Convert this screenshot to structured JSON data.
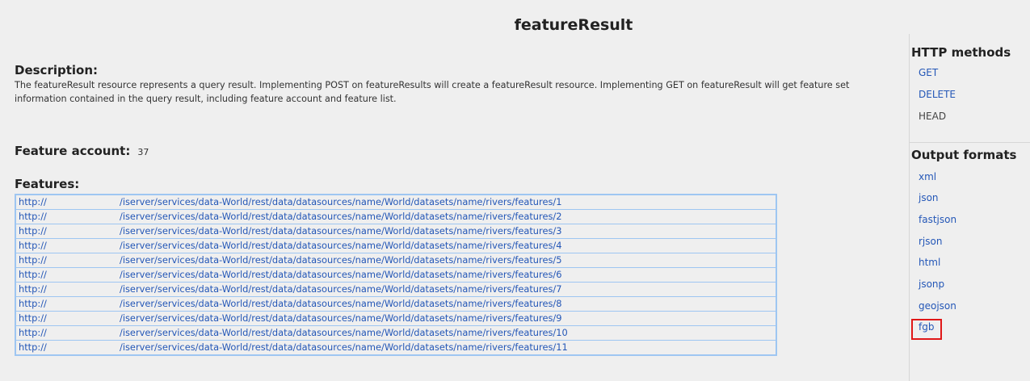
{
  "title": "featureResult",
  "description": {
    "heading": "Description:",
    "text": "The featureResult resource represents a query result. Implementing POST on featureResults will create a featureResult resource. Implementing GET on featureResult will get feature set information contained in the query result, including feature account and feature list."
  },
  "feature_account": {
    "label": "Feature account:",
    "value": "37"
  },
  "features": {
    "heading": "Features:",
    "rows": [
      {
        "scheme": "http://",
        "path": "/iserver/services/data-World/rest/data/datasources/name/World/datasets/name/rivers/features/1"
      },
      {
        "scheme": "http://",
        "path": "/iserver/services/data-World/rest/data/datasources/name/World/datasets/name/rivers/features/2"
      },
      {
        "scheme": "http://",
        "path": "/iserver/services/data-World/rest/data/datasources/name/World/datasets/name/rivers/features/3"
      },
      {
        "scheme": "http://",
        "path": "/iserver/services/data-World/rest/data/datasources/name/World/datasets/name/rivers/features/4"
      },
      {
        "scheme": "http://",
        "path": "/iserver/services/data-World/rest/data/datasources/name/World/datasets/name/rivers/features/5"
      },
      {
        "scheme": "http://",
        "path": "/iserver/services/data-World/rest/data/datasources/name/World/datasets/name/rivers/features/6"
      },
      {
        "scheme": "http://",
        "path": "/iserver/services/data-World/rest/data/datasources/name/World/datasets/name/rivers/features/7"
      },
      {
        "scheme": "http://",
        "path": "/iserver/services/data-World/rest/data/datasources/name/World/datasets/name/rivers/features/8"
      },
      {
        "scheme": "http://",
        "path": "/iserver/services/data-World/rest/data/datasources/name/World/datasets/name/rivers/features/9"
      },
      {
        "scheme": "http://",
        "path": "/iserver/services/data-World/rest/data/datasources/name/World/datasets/name/rivers/features/10"
      },
      {
        "scheme": "http://",
        "path": "/iserver/services/data-World/rest/data/datasources/name/World/datasets/name/rivers/features/11"
      }
    ]
  },
  "sidebar": {
    "http_methods": {
      "heading": "HTTP methods",
      "items": [
        "GET",
        "DELETE",
        "HEAD"
      ]
    },
    "output_formats": {
      "heading": "Output formats",
      "items": [
        "xml",
        "json",
        "fastjson",
        "rjson",
        "html",
        "jsonp",
        "geojson",
        "fgb"
      ]
    }
  },
  "colors": {
    "link": "#2457b7",
    "table_border": "#9ec6f2",
    "highlight": "#e01818",
    "background": "#efefef"
  }
}
